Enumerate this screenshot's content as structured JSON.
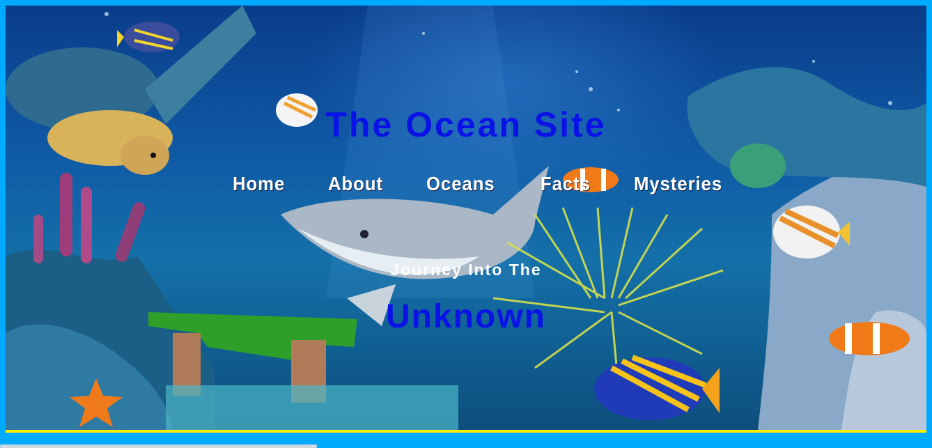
{
  "site": {
    "title": "The Ocean Site"
  },
  "nav": {
    "items": [
      {
        "label": "Home"
      },
      {
        "label": "About"
      },
      {
        "label": "Oceans"
      },
      {
        "label": "Facts"
      },
      {
        "label": "Mysteries"
      }
    ]
  },
  "hero": {
    "tagline_small": "Journey Into The",
    "tagline_big": "Unknown"
  },
  "colors": {
    "page_border": "#00aaff",
    "title_blue": "#0b12e6",
    "nav_text": "#ffffff",
    "bottom_bar": "#ffee00"
  },
  "icons": [
    "sea-turtle-icon",
    "shark-icon",
    "clownfish-icon",
    "angelfish-icon",
    "coral-icon",
    "starfish-icon",
    "butterflyfish-icon"
  ]
}
